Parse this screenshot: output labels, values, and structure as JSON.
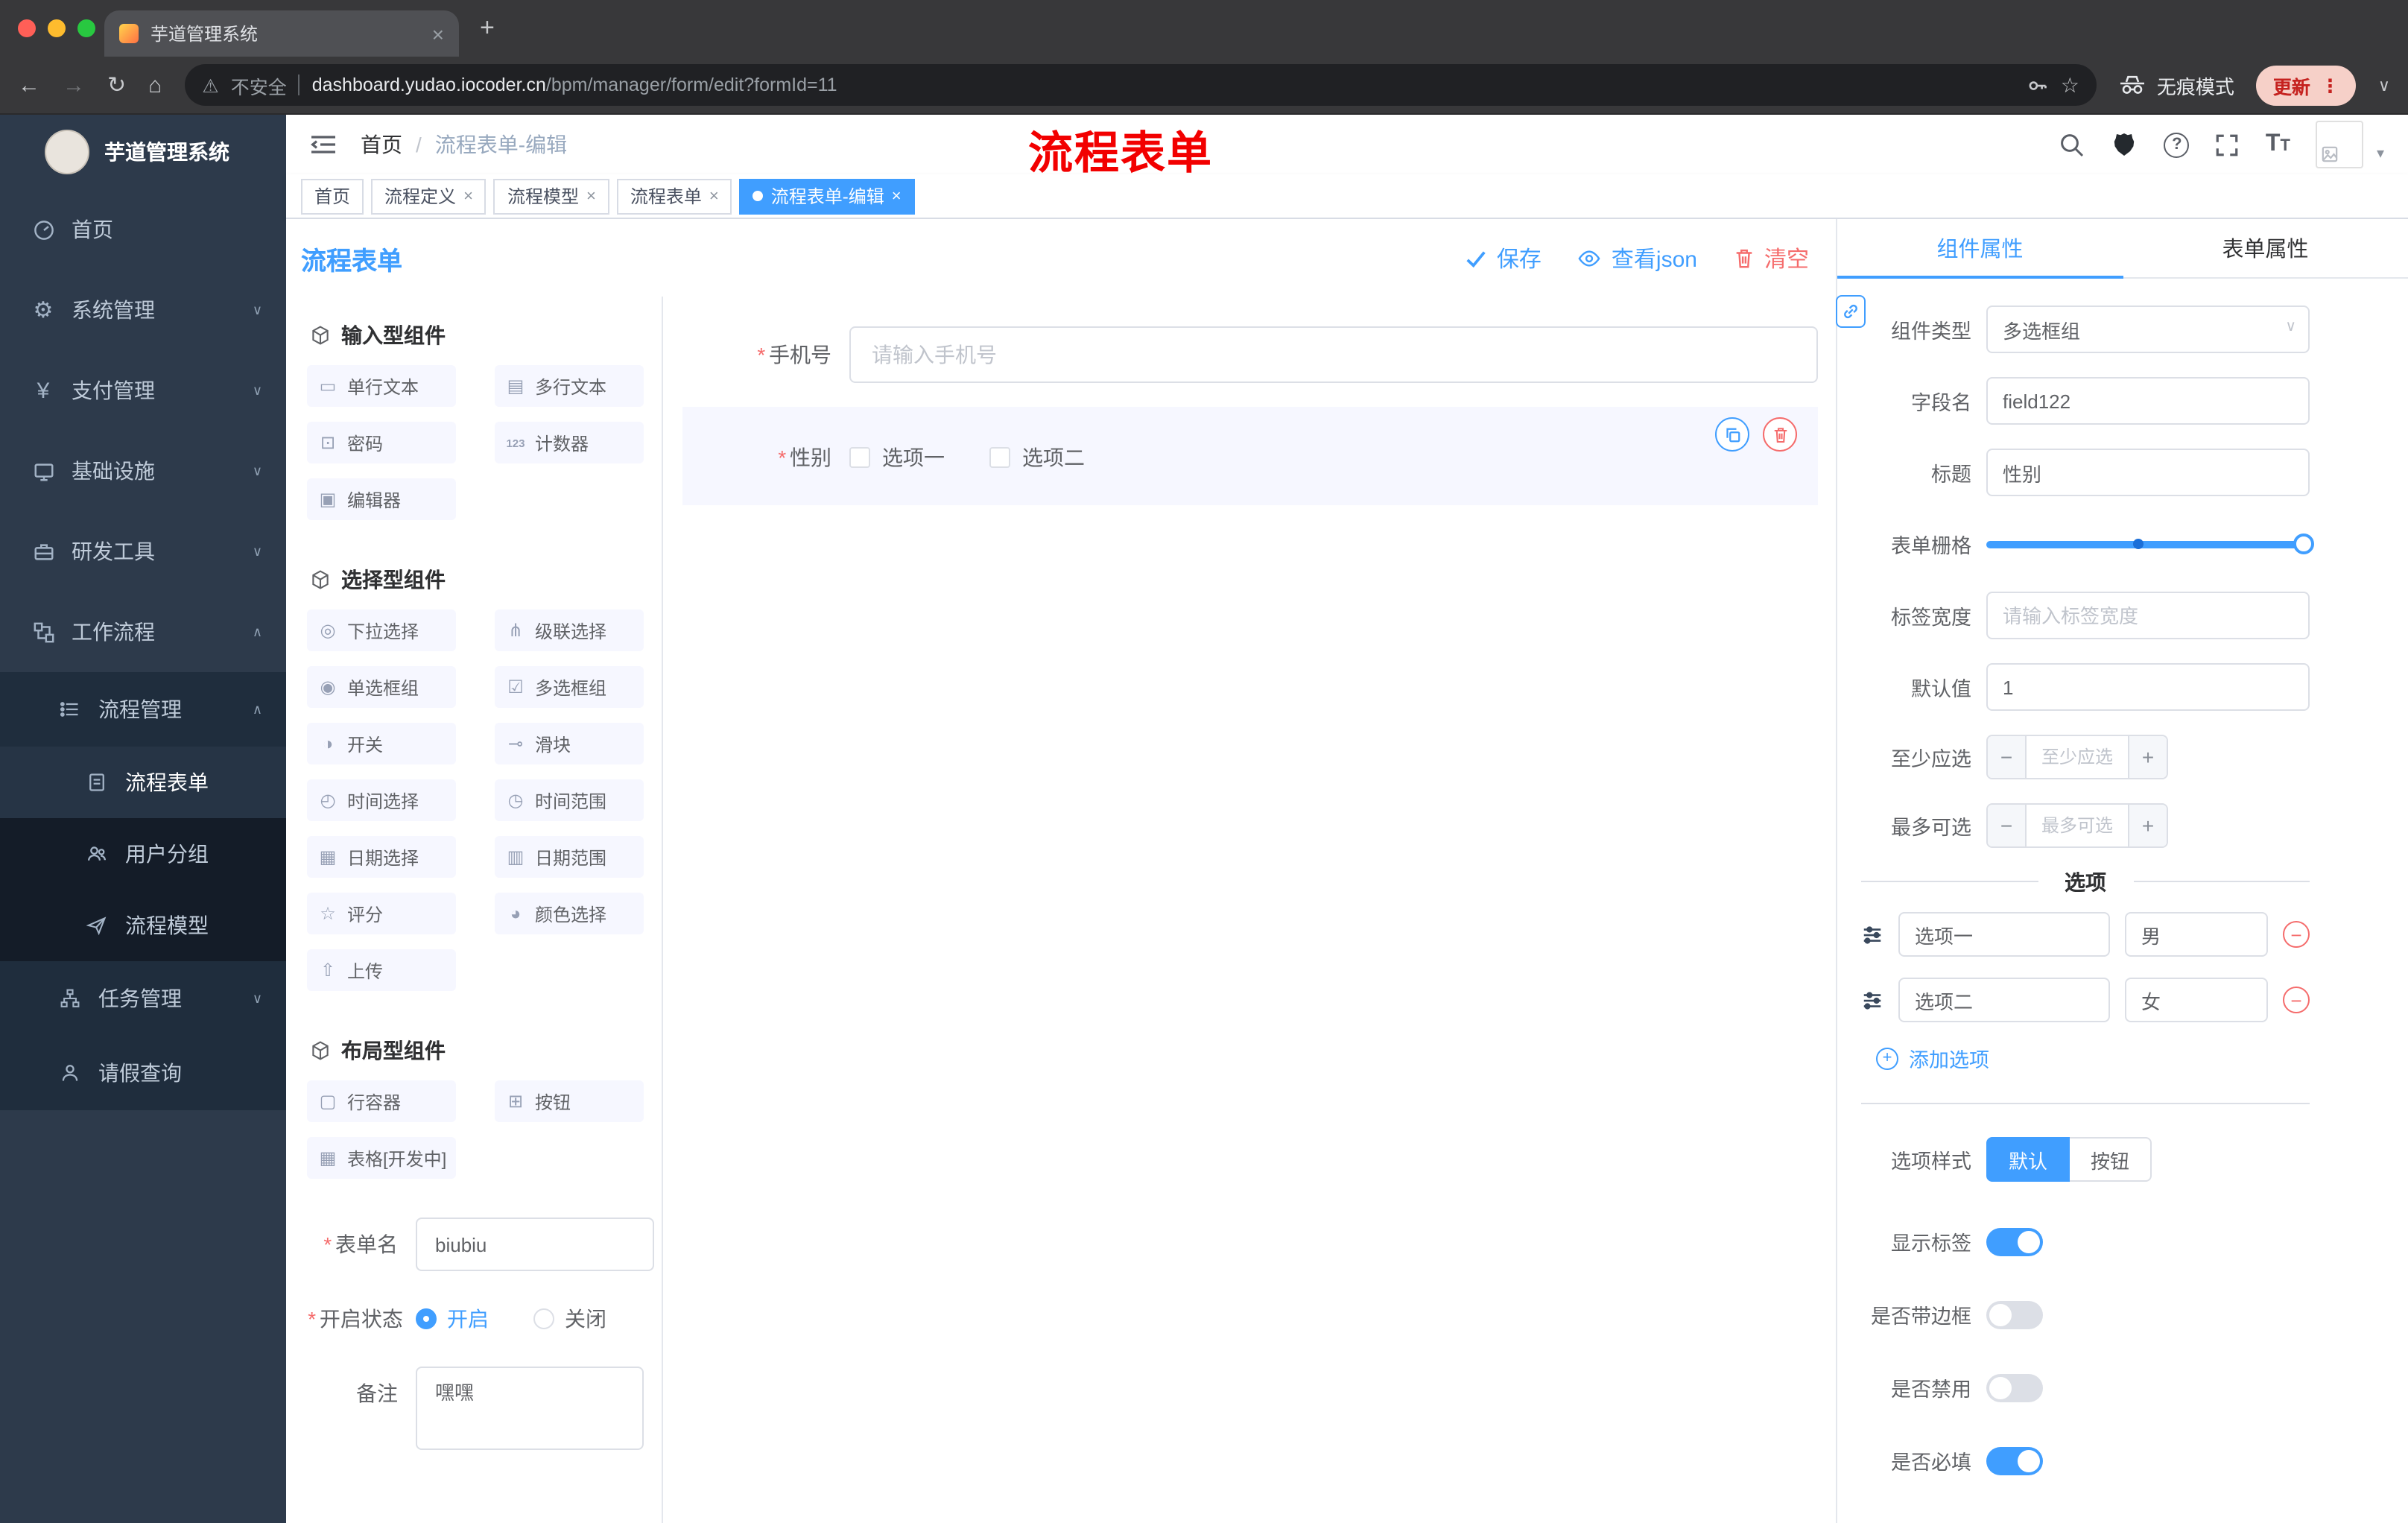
{
  "browser": {
    "tab_title": "芋道管理系统",
    "security_label": "不安全",
    "url_host": "dashboard.yudao.iocoder.cn",
    "url_path": "/bpm/manager/form/edit?formId=11",
    "incognito_label": "无痕模式",
    "update_label": "更新"
  },
  "annotation": {
    "text": "流程表单"
  },
  "sidebar": {
    "logo_title": "芋道管理系统",
    "items": [
      {
        "label": "首页"
      },
      {
        "label": "系统管理"
      },
      {
        "label": "支付管理"
      },
      {
        "label": "基础设施"
      },
      {
        "label": "研发工具"
      },
      {
        "label": "工作流程"
      },
      {
        "label": "流程管理"
      },
      {
        "label": "流程表单"
      },
      {
        "label": "用户分组"
      },
      {
        "label": "流程模型"
      },
      {
        "label": "任务管理"
      },
      {
        "label": "请假查询"
      }
    ]
  },
  "header": {
    "breadcrumb_home": "首页",
    "breadcrumb_sep": "/",
    "breadcrumb_current": "流程表单-编辑"
  },
  "tags": {
    "items": [
      {
        "label": "首页"
      },
      {
        "label": "流程定义"
      },
      {
        "label": "流程模型"
      },
      {
        "label": "流程表单"
      },
      {
        "label": "流程表单-编辑"
      }
    ]
  },
  "designer": {
    "title": "流程表单",
    "actions": {
      "save": "保存",
      "view_json": "查看json",
      "clear": "清空"
    },
    "palette": {
      "groups": [
        {
          "title": "输入型组件",
          "items": [
            {
              "label": "单行文本",
              "icon": "▭"
            },
            {
              "label": "多行文本",
              "icon": "▤"
            },
            {
              "label": "密码",
              "icon": "⊡"
            },
            {
              "label": "计数器",
              "icon": "123"
            },
            {
              "label": "编辑器",
              "icon": "▣"
            }
          ]
        },
        {
          "title": "选择型组件",
          "items": [
            {
              "label": "下拉选择",
              "icon": "◎"
            },
            {
              "label": "级联选择",
              "icon": "⋔"
            },
            {
              "label": "单选框组",
              "icon": "◉"
            },
            {
              "label": "多选框组",
              "icon": "☑"
            },
            {
              "label": "开关",
              "icon": "◑"
            },
            {
              "label": "滑块",
              "icon": "⊸"
            },
            {
              "label": "时间选择",
              "icon": "◴"
            },
            {
              "label": "时间范围",
              "icon": "◷"
            },
            {
              "label": "日期选择",
              "icon": "▦"
            },
            {
              "label": "日期范围",
              "icon": "▥"
            },
            {
              "label": "评分",
              "icon": "☆"
            },
            {
              "label": "颜色选择",
              "icon": "◕"
            },
            {
              "label": "上传",
              "icon": "⇧"
            }
          ]
        },
        {
          "title": "布局型组件",
          "items": [
            {
              "label": "行容器",
              "icon": "▢"
            },
            {
              "label": "按钮",
              "icon": "⊞"
            },
            {
              "label": "表格[开发中]",
              "icon": "▦"
            }
          ]
        }
      ]
    },
    "meta": {
      "name_label": "表单名",
      "name_value": "biubiu",
      "status_label": "开启状态",
      "status_on": "开启",
      "status_off": "关闭",
      "remark_label": "备注",
      "remark_value": "嘿嘿"
    },
    "canvas": {
      "phone_label": "手机号",
      "phone_placeholder": "请输入手机号",
      "gender_label": "性别",
      "gender_options": [
        "选项一",
        "选项二"
      ]
    }
  },
  "props": {
    "tab_component": "组件属性",
    "tab_form": "表单属性",
    "type_label": "组件类型",
    "type_value": "多选框组",
    "field_label": "字段名",
    "field_value": "field122",
    "title_label": "标题",
    "title_value": "性别",
    "grid_label": "表单栅格",
    "label_width_label": "标签宽度",
    "label_width_placeholder": "请输入标签宽度",
    "default_label": "默认值",
    "default_value": "1",
    "min_label": "至少应选",
    "min_placeholder": "至少应选",
    "max_label": "最多可选",
    "max_placeholder": "最多可选",
    "options_divider": "选项",
    "option_rows": [
      {
        "label": "选项一",
        "value": "男"
      },
      {
        "label": "选项二",
        "value": "女"
      }
    ],
    "add_option": "添加选项",
    "style_label": "选项样式",
    "style_default": "默认",
    "style_button": "按钮",
    "switch_show_label": "显示标签",
    "switch_border": "是否带边框",
    "switch_disabled": "是否禁用",
    "switch_required": "是否必填"
  },
  "colors": {
    "primary": "#409eff",
    "danger": "#f56c6c"
  }
}
